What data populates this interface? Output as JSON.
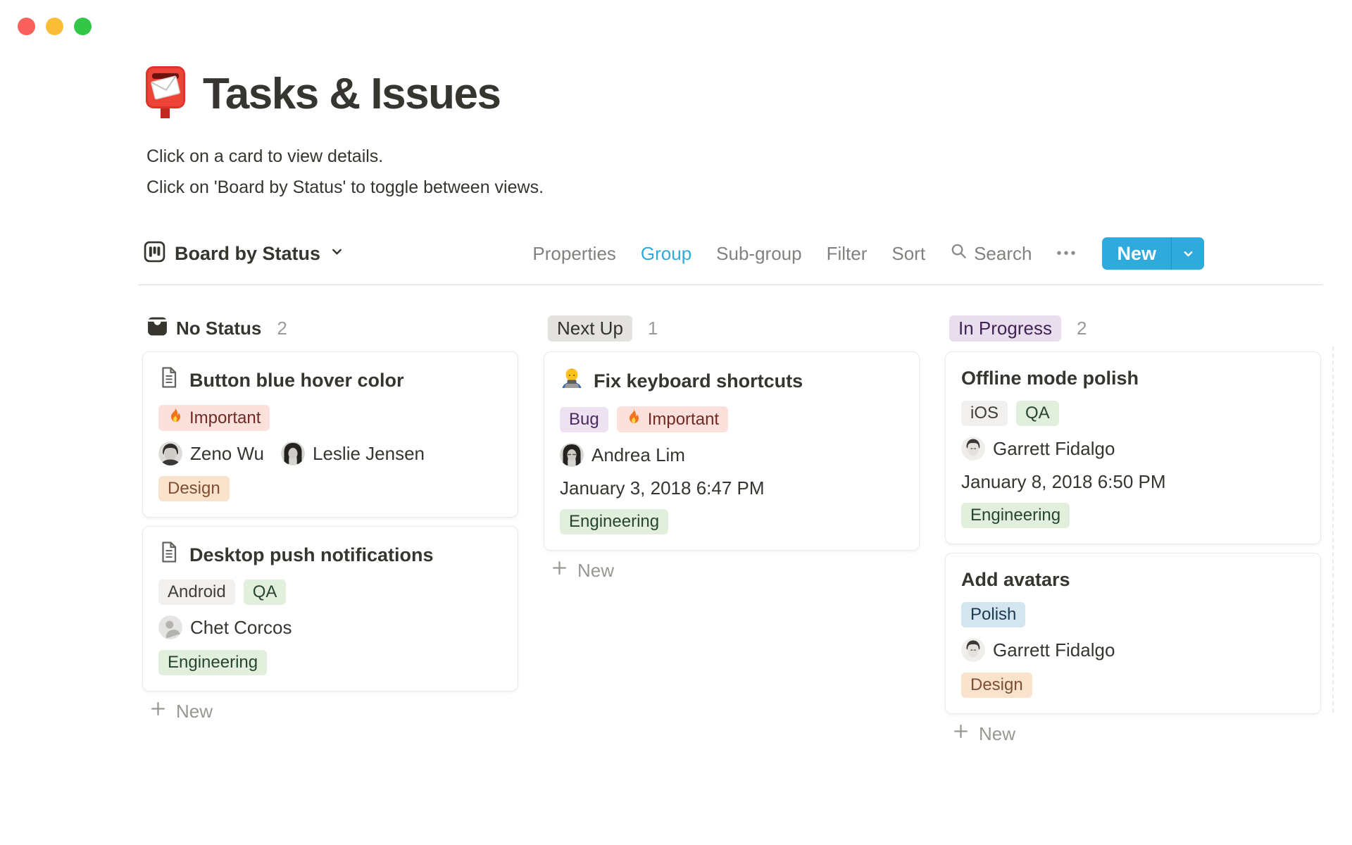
{
  "window": {
    "traffic_lights": [
      "close",
      "minimize",
      "zoom"
    ]
  },
  "page": {
    "icon": "postbox-emoji",
    "title": "Tasks & Issues",
    "subtitle_line1": "Click on a card to view details.",
    "subtitle_line2": "Click on 'Board by Status' to toggle between views."
  },
  "toolbar": {
    "view": {
      "icon": "board-view-icon",
      "label": "Board by Status"
    },
    "menu": {
      "properties": "Properties",
      "group": "Group",
      "subgroup": "Sub-group",
      "filter": "Filter",
      "sort": "Sort",
      "search": "Search",
      "more": "•••"
    },
    "new_button": {
      "label": "New"
    }
  },
  "board": {
    "columns": [
      {
        "header": {
          "label": "No Status",
          "count": "2",
          "style": "plain",
          "icon": "inbox-icon"
        },
        "new_label": "New",
        "cards": [
          {
            "icon": "page-icon",
            "title": "Button blue hover color",
            "tags_top": [
              {
                "label": "Important",
                "variant": "red",
                "fire": true
              }
            ],
            "people": [
              {
                "name": "Zeno Wu",
                "avatar": "photo"
              },
              {
                "name": "Leslie Jensen",
                "avatar": "photo"
              }
            ],
            "tags_bottom": [
              {
                "label": "Design",
                "variant": "orange"
              }
            ]
          },
          {
            "icon": "page-icon",
            "title": "Desktop push notifications",
            "tags_top": [
              {
                "label": "Android",
                "variant": "gray"
              },
              {
                "label": "QA",
                "variant": "green"
              }
            ],
            "people": [
              {
                "name": "Chet Corcos",
                "avatar": "placeholder"
              }
            ],
            "tags_bottom": [
              {
                "label": "Engineering",
                "variant": "green"
              }
            ]
          }
        ]
      },
      {
        "header": {
          "label": "Next Up",
          "count": "1",
          "style": "badge-gray"
        },
        "new_label": "New",
        "cards": [
          {
            "icon": "technologist-emoji",
            "title": "Fix keyboard shortcuts",
            "tags_top": [
              {
                "label": "Bug",
                "variant": "purple"
              },
              {
                "label": "Important",
                "variant": "red",
                "fire": true
              }
            ],
            "people": [
              {
                "name": "Andrea Lim",
                "avatar": "photo"
              }
            ],
            "date": "January 3, 2018 6:47 PM",
            "tags_bottom": [
              {
                "label": "Engineering",
                "variant": "green"
              }
            ]
          }
        ]
      },
      {
        "header": {
          "label": "In Progress",
          "count": "2",
          "style": "badge-purple"
        },
        "new_label": "New",
        "cards": [
          {
            "title": "Offline mode polish",
            "tags_top": [
              {
                "label": "iOS",
                "variant": "gray"
              },
              {
                "label": "QA",
                "variant": "green"
              }
            ],
            "people": [
              {
                "name": "Garrett Fidalgo",
                "avatar": "photo"
              }
            ],
            "date": "January 8, 2018 6:50 PM",
            "tags_bottom": [
              {
                "label": "Engineering",
                "variant": "green"
              }
            ]
          },
          {
            "title": "Add avatars",
            "tags_top": [
              {
                "label": "Polish",
                "variant": "blue"
              }
            ],
            "people": [
              {
                "name": "Garrett Fidalgo",
                "avatar": "photo"
              }
            ],
            "tags_bottom": [
              {
                "label": "Design",
                "variant": "orange"
              }
            ]
          }
        ]
      }
    ]
  },
  "colors": {
    "accent_blue": "#2EAADC",
    "text_primary": "#37352F",
    "text_muted": "#82817D",
    "count_gray": "#9B9A97",
    "tag_red_bg": "#FBE0DC",
    "tag_red_text": "#6E2B25",
    "tag_orange_bg": "#FAE3CD",
    "tag_orange_text": "#7E4F33",
    "tag_gray_bg": "#F1F0EE",
    "tag_gray_text": "#403E3A",
    "tag_green_bg": "#E1EFDC",
    "tag_green_text": "#28462F",
    "tag_purple_bg": "#EDE2F2",
    "tag_purple_text": "#4B2A60",
    "tag_blue_bg": "#D3E5EF",
    "tag_blue_text": "#1B3A50",
    "column_badge_gray_bg": "#E3E2DF",
    "column_badge_purple_bg": "#E8DEEE",
    "traffic_red": "#FB605C",
    "traffic_yellow": "#FCBD36",
    "traffic_green": "#33C748"
  }
}
